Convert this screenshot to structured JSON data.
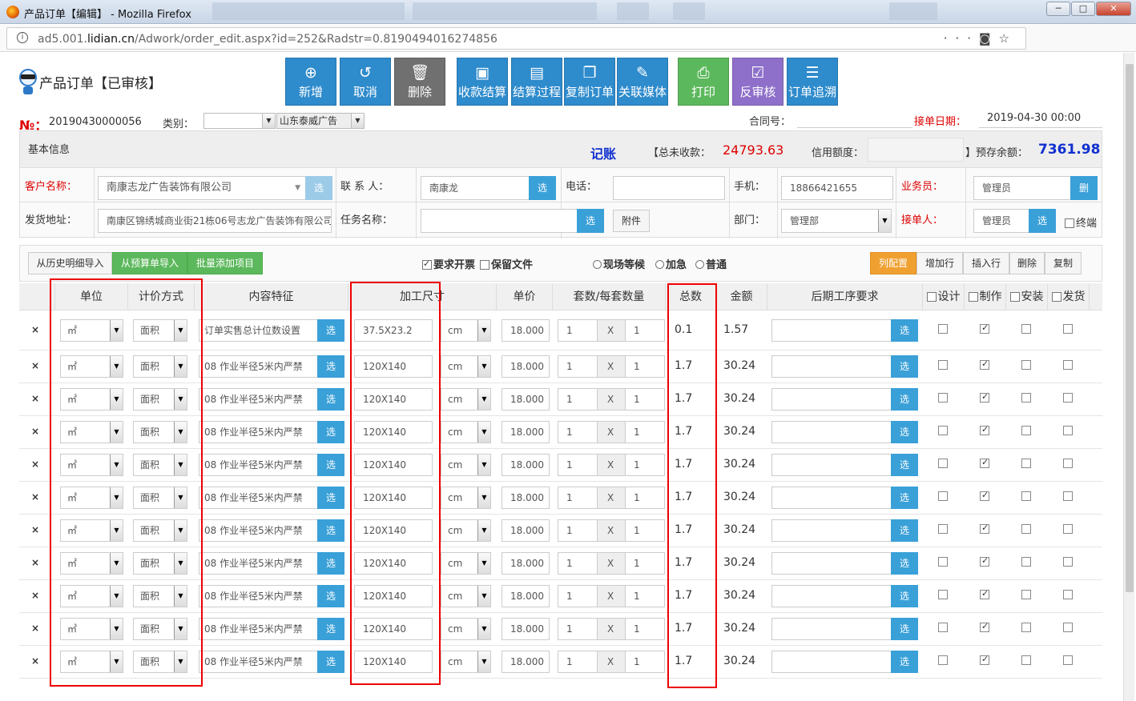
{
  "window": {
    "title": "产品订单【编辑】 - Mozilla Firefox",
    "url_prefix": "ad5.001.",
    "url_host": "lidian.cn",
    "url_path": "/Adwork/order_edit.aspx?id=252&Radstr=0.8190494016274856",
    "min": "─",
    "max": "□",
    "close": "✕"
  },
  "page": {
    "title": "产品订单【已审核】",
    "toolbar": [
      {
        "label": "新增",
        "icon": "plus-circle-icon",
        "glyph": "⊕",
        "color": "blue"
      },
      {
        "label": "取消",
        "icon": "undo-icon",
        "glyph": "↺",
        "color": "blue"
      },
      {
        "label": "删除",
        "icon": "trash-icon",
        "glyph": "🗑",
        "color": "gray"
      },
      {
        "label": "收款结算",
        "icon": "money-icon",
        "glyph": "▣",
        "color": "blue"
      },
      {
        "label": "结算过程",
        "icon": "document-icon",
        "glyph": "▤",
        "color": "blue"
      },
      {
        "label": "复制订单",
        "icon": "copy-icon",
        "glyph": "❐",
        "color": "blue"
      },
      {
        "label": "关联媒体",
        "icon": "paperclip-icon",
        "glyph": "✎",
        "color": "blue"
      },
      {
        "label": "打印",
        "icon": "printer-icon",
        "glyph": "⎙",
        "color": "green"
      },
      {
        "label": "反审核",
        "icon": "check-square-icon",
        "glyph": "☑",
        "color": "purple"
      },
      {
        "label": "订单追溯",
        "icon": "list-icon",
        "glyph": "☰",
        "color": "blue"
      }
    ]
  },
  "order_meta": {
    "no_label": "№：",
    "no_value": "20190430000056",
    "category_label": "类别：",
    "category_value": "",
    "company_value": "山东泰威广告",
    "contract_label": "合同号：",
    "contract_value": "",
    "date_label": "接单日期：",
    "date_value": "2019-04-30 00:00"
  },
  "info": {
    "section_label": "基本信息",
    "account_label": "记账",
    "unpaid_label": "【总未收款：",
    "unpaid_value": "24793.63",
    "credit_label": "信用额度：",
    "credit_value": "",
    "prepay_label": "】预存余额：",
    "prepay_value": "7361.98",
    "customer_label": "客户名称：",
    "customer_value": "南康志龙广告装饰有限公司",
    "contact_label": "联 系 人：",
    "contact_value": "南康龙",
    "phone_label": "电话：",
    "phone_value": "",
    "mobile_label": "手机：",
    "mobile_value": "18866421655",
    "salesman_label": "业务员：",
    "salesman_value": "管理员",
    "delete_btn": "删",
    "address_label": "发货地址：",
    "address_value": "南康区锦绣城商业街21栋06号志龙广告装饰有限公司",
    "task_label": "任务名称：",
    "task_value": "",
    "attach_btn": "附件",
    "dept_label": "部门：",
    "dept_value": "管理部",
    "receiver_label": "接单人：",
    "receiver_value": "管理员",
    "terminal_label": "终端",
    "pick": "选"
  },
  "actions": {
    "history_import": "从历史明细导入",
    "budget_import": "从预算单导入",
    "batch_add": "批量添加项目",
    "invoice": "要求开票",
    "keep_file": "保留文件",
    "onsite": "现场等候",
    "urgent": "加急",
    "normal": "普通",
    "col_config": "列配置",
    "add_row": "增加行",
    "insert_row": "插入行",
    "delete": "删除",
    "copy": "复制"
  },
  "grid": {
    "headers": {
      "unit": "单位",
      "pricing": "计价方式",
      "content": "内容特征",
      "size": "加工尺寸",
      "price": "单价",
      "sets": "套数/每套数量",
      "total": "总数",
      "amount": "金额",
      "post": "后期工序要求",
      "design": "设计",
      "make": "制作",
      "install": "安装",
      "ship": "发货"
    },
    "del_glyph": "×",
    "x_glyph": "X",
    "pick": "选",
    "rows": [
      {
        "unit": "㎡",
        "pricing": "面积",
        "content": "订单实售总计位数设置",
        "size": "37.5X23.2",
        "size_unit": "cm",
        "price": "18.000",
        "sets": "1",
        "qty": "1",
        "total": "0.1",
        "amount": "1.57",
        "post": "",
        "design": false,
        "make": true,
        "install": false,
        "ship": false
      },
      {
        "unit": "㎡",
        "pricing": "面积",
        "content": "08 作业半径5米内严禁",
        "size": "120X140",
        "size_unit": "cm",
        "price": "18.000",
        "sets": "1",
        "qty": "1",
        "total": "1.7",
        "amount": "30.24",
        "post": "",
        "design": false,
        "make": true,
        "install": false,
        "ship": false
      },
      {
        "unit": "㎡",
        "pricing": "面积",
        "content": "08 作业半径5米内严禁",
        "size": "120X140",
        "size_unit": "cm",
        "price": "18.000",
        "sets": "1",
        "qty": "1",
        "total": "1.7",
        "amount": "30.24",
        "post": "",
        "design": false,
        "make": true,
        "install": false,
        "ship": false
      },
      {
        "unit": "㎡",
        "pricing": "面积",
        "content": "08 作业半径5米内严禁",
        "size": "120X140",
        "size_unit": "cm",
        "price": "18.000",
        "sets": "1",
        "qty": "1",
        "total": "1.7",
        "amount": "30.24",
        "post": "",
        "design": false,
        "make": true,
        "install": false,
        "ship": false
      },
      {
        "unit": "㎡",
        "pricing": "面积",
        "content": "08 作业半径5米内严禁",
        "size": "120X140",
        "size_unit": "cm",
        "price": "18.000",
        "sets": "1",
        "qty": "1",
        "total": "1.7",
        "amount": "30.24",
        "post": "",
        "design": false,
        "make": true,
        "install": false,
        "ship": false
      },
      {
        "unit": "㎡",
        "pricing": "面积",
        "content": "08 作业半径5米内严禁",
        "size": "120X140",
        "size_unit": "cm",
        "price": "18.000",
        "sets": "1",
        "qty": "1",
        "total": "1.7",
        "amount": "30.24",
        "post": "",
        "design": false,
        "make": true,
        "install": false,
        "ship": false
      },
      {
        "unit": "㎡",
        "pricing": "面积",
        "content": "08 作业半径5米内严禁",
        "size": "120X140",
        "size_unit": "cm",
        "price": "18.000",
        "sets": "1",
        "qty": "1",
        "total": "1.7",
        "amount": "30.24",
        "post": "",
        "design": false,
        "make": true,
        "install": false,
        "ship": false
      },
      {
        "unit": "㎡",
        "pricing": "面积",
        "content": "08 作业半径5米内严禁",
        "size": "120X140",
        "size_unit": "cm",
        "price": "18.000",
        "sets": "1",
        "qty": "1",
        "total": "1.7",
        "amount": "30.24",
        "post": "",
        "design": false,
        "make": true,
        "install": false,
        "ship": false
      },
      {
        "unit": "㎡",
        "pricing": "面积",
        "content": "08 作业半径5米内严禁",
        "size": "120X140",
        "size_unit": "cm",
        "price": "18.000",
        "sets": "1",
        "qty": "1",
        "total": "1.7",
        "amount": "30.24",
        "post": "",
        "design": false,
        "make": true,
        "install": false,
        "ship": false
      },
      {
        "unit": "㎡",
        "pricing": "面积",
        "content": "08 作业半径5米内严禁",
        "size": "120X140",
        "size_unit": "cm",
        "price": "18.000",
        "sets": "1",
        "qty": "1",
        "total": "1.7",
        "amount": "30.24",
        "post": "",
        "design": false,
        "make": true,
        "install": false,
        "ship": false
      },
      {
        "unit": "㎡",
        "pricing": "面积",
        "content": "08 作业半径5米内严禁",
        "size": "120X140",
        "size_unit": "cm",
        "price": "18.000",
        "sets": "1",
        "qty": "1",
        "total": "1.7",
        "amount": "30.24",
        "post": "",
        "design": false,
        "make": true,
        "install": false,
        "ship": false
      }
    ]
  }
}
